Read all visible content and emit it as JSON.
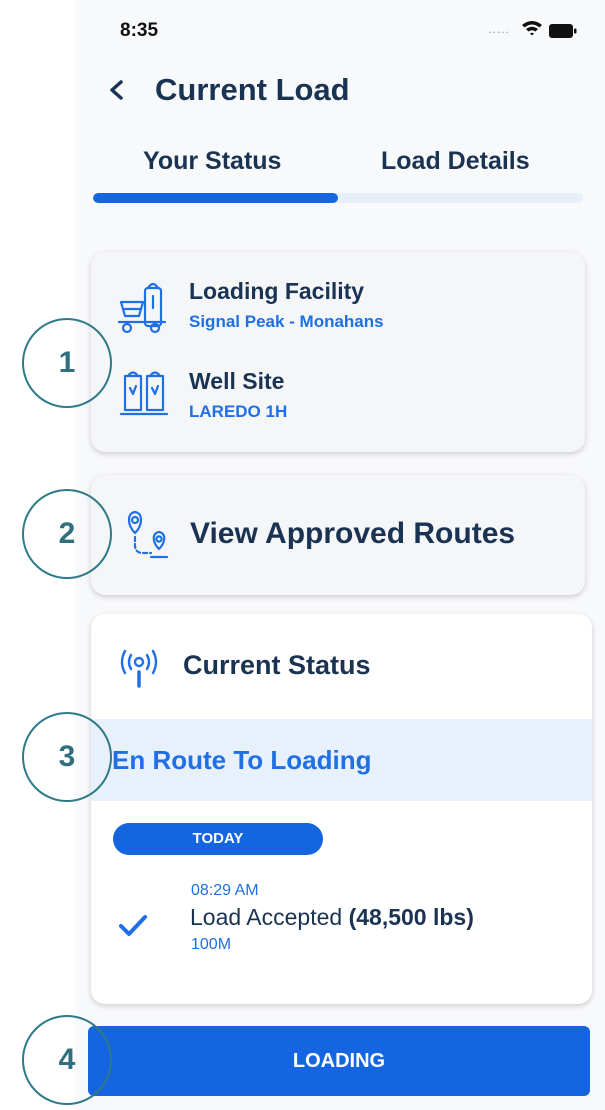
{
  "status_bar": {
    "time": "8:35",
    "signal_dots": "....."
  },
  "header": {
    "title": "Current Load"
  },
  "tabs": [
    {
      "label": "Your Status"
    },
    {
      "label": "Load Details"
    }
  ],
  "locations": {
    "loading_facility": {
      "title": "Loading Facility",
      "name": "Signal Peak - Monahans"
    },
    "well_site": {
      "title": "Well Site",
      "name": "LAREDO 1H"
    }
  },
  "routes": {
    "label": "View Approved Routes"
  },
  "current_status": {
    "heading": "Current Status",
    "value": "En Route To Loading",
    "date_label": "TODAY",
    "event": {
      "time": "08:29 AM",
      "label": "Load Accepted",
      "weight": "(48,500 lbs)",
      "distance": "100M"
    }
  },
  "action_button": {
    "label": "LOADING"
  },
  "callouts": [
    "1",
    "2",
    "3",
    "4"
  ],
  "colors": {
    "accent": "#1565e0",
    "heading": "#1a3352",
    "callout": "#2f7a88"
  }
}
